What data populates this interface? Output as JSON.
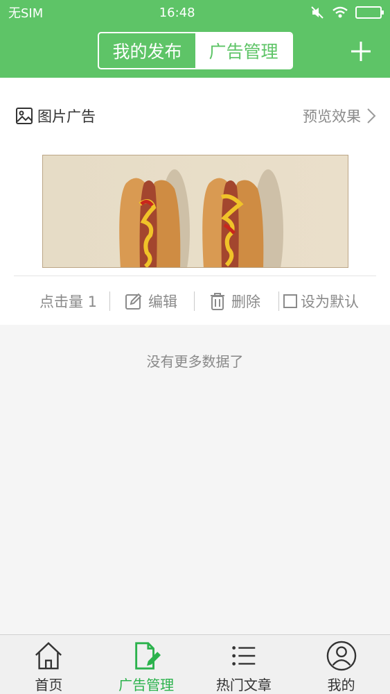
{
  "status_bar": {
    "carrier": "无SIM",
    "time": "16:48"
  },
  "header": {
    "segments": [
      {
        "label": "我的发布",
        "active": false
      },
      {
        "label": "广告管理",
        "active": true
      }
    ],
    "add_icon": "plus-icon"
  },
  "ad_card": {
    "title": "图片广告",
    "title_icon": "image-icon",
    "preview_label": "预览效果",
    "image_alt": "hot-dog-ad-image",
    "actions": {
      "clicks": "点击量 1",
      "edit": "编辑",
      "delete": "删除",
      "set_default": "设为默认"
    }
  },
  "list_footer": "没有更多数据了",
  "tabbar": {
    "items": [
      {
        "label": "首页",
        "icon": "home-icon",
        "active": false
      },
      {
        "label": "广告管理",
        "icon": "ad-edit-icon",
        "active": true
      },
      {
        "label": "热门文章",
        "icon": "list-icon",
        "active": false
      },
      {
        "label": "我的",
        "icon": "user-icon",
        "active": false
      }
    ]
  },
  "colors": {
    "brand_green": "#5ec467",
    "tab_active": "#2bb24c"
  }
}
